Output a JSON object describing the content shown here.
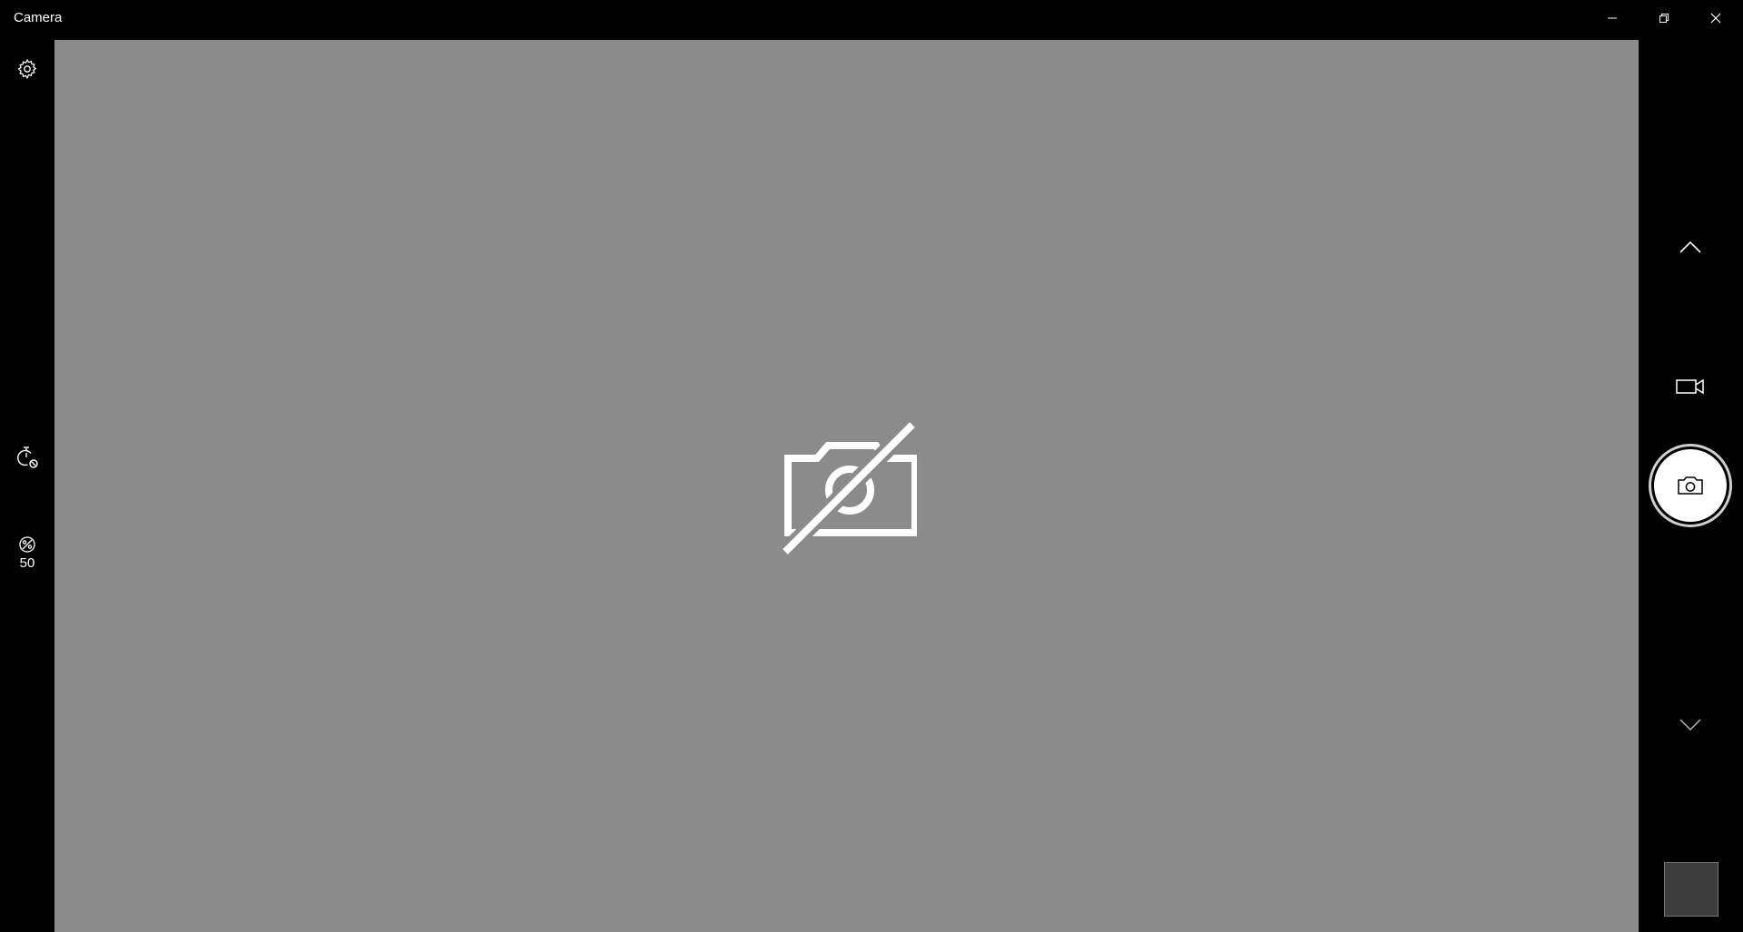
{
  "window": {
    "title": "Camera",
    "controls": {
      "minimize": "minimize-icon",
      "restore": "restore-icon",
      "close": "close-icon"
    }
  },
  "left_toolbar": {
    "settings_icon": "gear-icon",
    "timer_icon": "timer-off-icon",
    "brightness_icon": "brightness-icon",
    "brightness_value": "50"
  },
  "viewfinder": {
    "status_icon": "camera-disabled-icon",
    "background": "#8b8b8c"
  },
  "right_panel": {
    "scroll_up_icon": "chevron-up-icon",
    "video_mode_icon": "video-camera-icon",
    "shutter_icon": "camera-icon",
    "scroll_down_icon": "chevron-down-icon",
    "thumbnail_color": "#3b3b3b"
  },
  "colors": {
    "chrome": "#000000",
    "foreground": "#ffffff",
    "viewfinder": "#8b8b8c"
  }
}
